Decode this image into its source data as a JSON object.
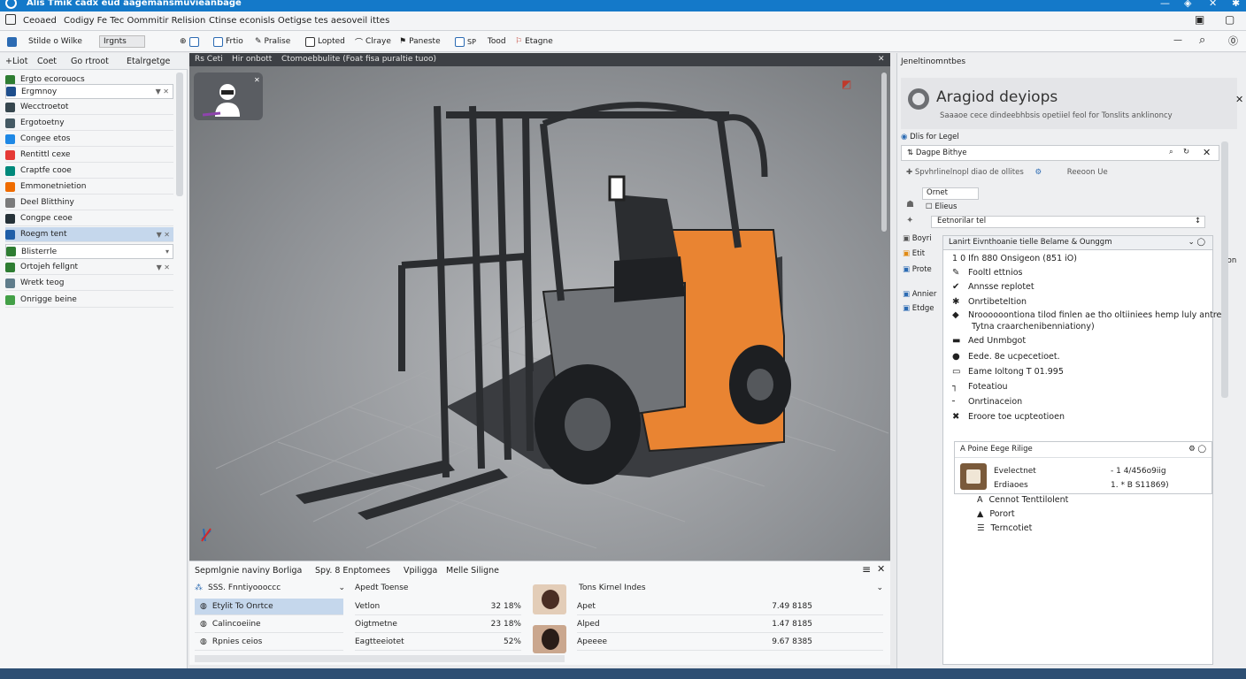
{
  "window": {
    "title": "Alis Tmik cadx eud aagemansmuvieanbage"
  },
  "menu": [
    "Ceoaed",
    "Codigy Fe Tec Oommitir Relision",
    "Ctinse econisls Oetigse tes aesoveil ittes"
  ],
  "toolbar": [
    "Stilde o Wilke",
    "Irgnts",
    "Frtio",
    "Pralise",
    "Lopted",
    "Clraye",
    "Paneste",
    "Tood",
    "Etagne"
  ],
  "left_panel": {
    "tabs": [
      "+Liot",
      "Coet",
      "Go rtroot",
      "Etalrgetge"
    ],
    "items": [
      {
        "label": "Ergto ecorouocs",
        "color": "#2e7d32"
      },
      {
        "label": "Ergmnoy",
        "color": "#1e4e8c"
      },
      {
        "label": "Wecctroetot",
        "color": "#37474f"
      },
      {
        "label": "Ergotoetny",
        "color": "#455a64"
      },
      {
        "label": "Congee etos",
        "color": "#1e88e5"
      },
      {
        "label": "Rentittl cexe",
        "color": "#e53935"
      },
      {
        "label": "Craptfe cooe",
        "color": "#00897b"
      },
      {
        "label": "Emmonetnietion",
        "color": "#ef6c00"
      },
      {
        "label": "Deel Blitthiny",
        "color": "#7b7b7b"
      },
      {
        "label": "Congpe ceoe",
        "color": "#263238"
      },
      {
        "label": "Roegm tent",
        "color": "#1f5ea8"
      },
      {
        "label": "Blisterrle",
        "color": "#2e7d32"
      },
      {
        "label": "Ortojeh fellgnt",
        "color": "#2e7d32"
      },
      {
        "label": "Wretk teog",
        "color": "#607d8b"
      },
      {
        "label": "Onrigge beine",
        "color": "#43a047"
      }
    ]
  },
  "viewport": {
    "tabs": [
      "Rs Ceti",
      "Hir onbott",
      "Ctomoebbulite (Foat fisa puraltie tuoo)"
    ]
  },
  "bottom_panel": {
    "tabs": [
      "Sepmlgnie naviny",
      "Borliga",
      "Spy. 8 Enptomees",
      "Vpiligga",
      "Melle Siligne"
    ],
    "left_header": "SSS. Fnntiyoooccc",
    "left_rows": [
      "Etylit To Onrtce",
      "Calincoeiine",
      "Rpnies ceios"
    ],
    "mid_header": "Apedt Toense",
    "mid_rows": [
      [
        "Vetlon",
        "32 18%"
      ],
      [
        "Oigtmetne",
        "23 18%"
      ],
      [
        "Eagtteeiotet",
        "52%"
      ]
    ],
    "right_header": "Tons Kirnel Indes",
    "right_rows": [
      [
        "Apet",
        "7.49 8185"
      ],
      [
        "Alped",
        "1.47 8185"
      ],
      [
        "Apeeee",
        "9.67 8385"
      ]
    ]
  },
  "right_panel": {
    "breadcrumb": "Jeneltinomntbes",
    "title": "Aragiod deyiops",
    "subtitle": "Saaaoe cece dindeebhbsis opetiiel feol for Tonslits anklinoncy",
    "section": "Dlis for Legel",
    "subsection": "Dagpe Bithye",
    "filter": "Spvhrlinelnopl diao de ollites",
    "filter_right": "Reeoon Ue",
    "field1": "Ornet",
    "check": "Elieus",
    "input": "Eetnorilar tel",
    "side": [
      "Boyri",
      "Etit",
      "Prote",
      "Annier",
      "Etdge"
    ],
    "right_edge": "con"
  },
  "dialog": {
    "dropdown": "Lanirt Eivnthoanie tielle Belame & Ounggm",
    "items": [
      "1 0 Ifn 880 Onsigeon (851 iO)",
      "Fooltl ettnios",
      "Annsse replotet",
      "Onrtibeteltion",
      "Nroooooontiona tilod finlen ae tho oltiiniees hemp luly antre",
      "Tytna craarchenibenniationy)",
      "Aed Unmbgot",
      "Eede. 8e ucpecetioet.",
      "Eame Ioltong T 01.995",
      "Foteatiou",
      "Onrtinaceion",
      "Eroore toe ucpteotioen"
    ],
    "sub_header": "Poine Eege Rilige",
    "card": {
      "name": "Evelectnet",
      "name2": "Erdiaoes",
      "v1": "- 1 4/456o9iig",
      "v2": "1. * B S11869)"
    },
    "tail": [
      "Cennot Tenttilolent",
      "Porort",
      "Terncotiet"
    ]
  }
}
